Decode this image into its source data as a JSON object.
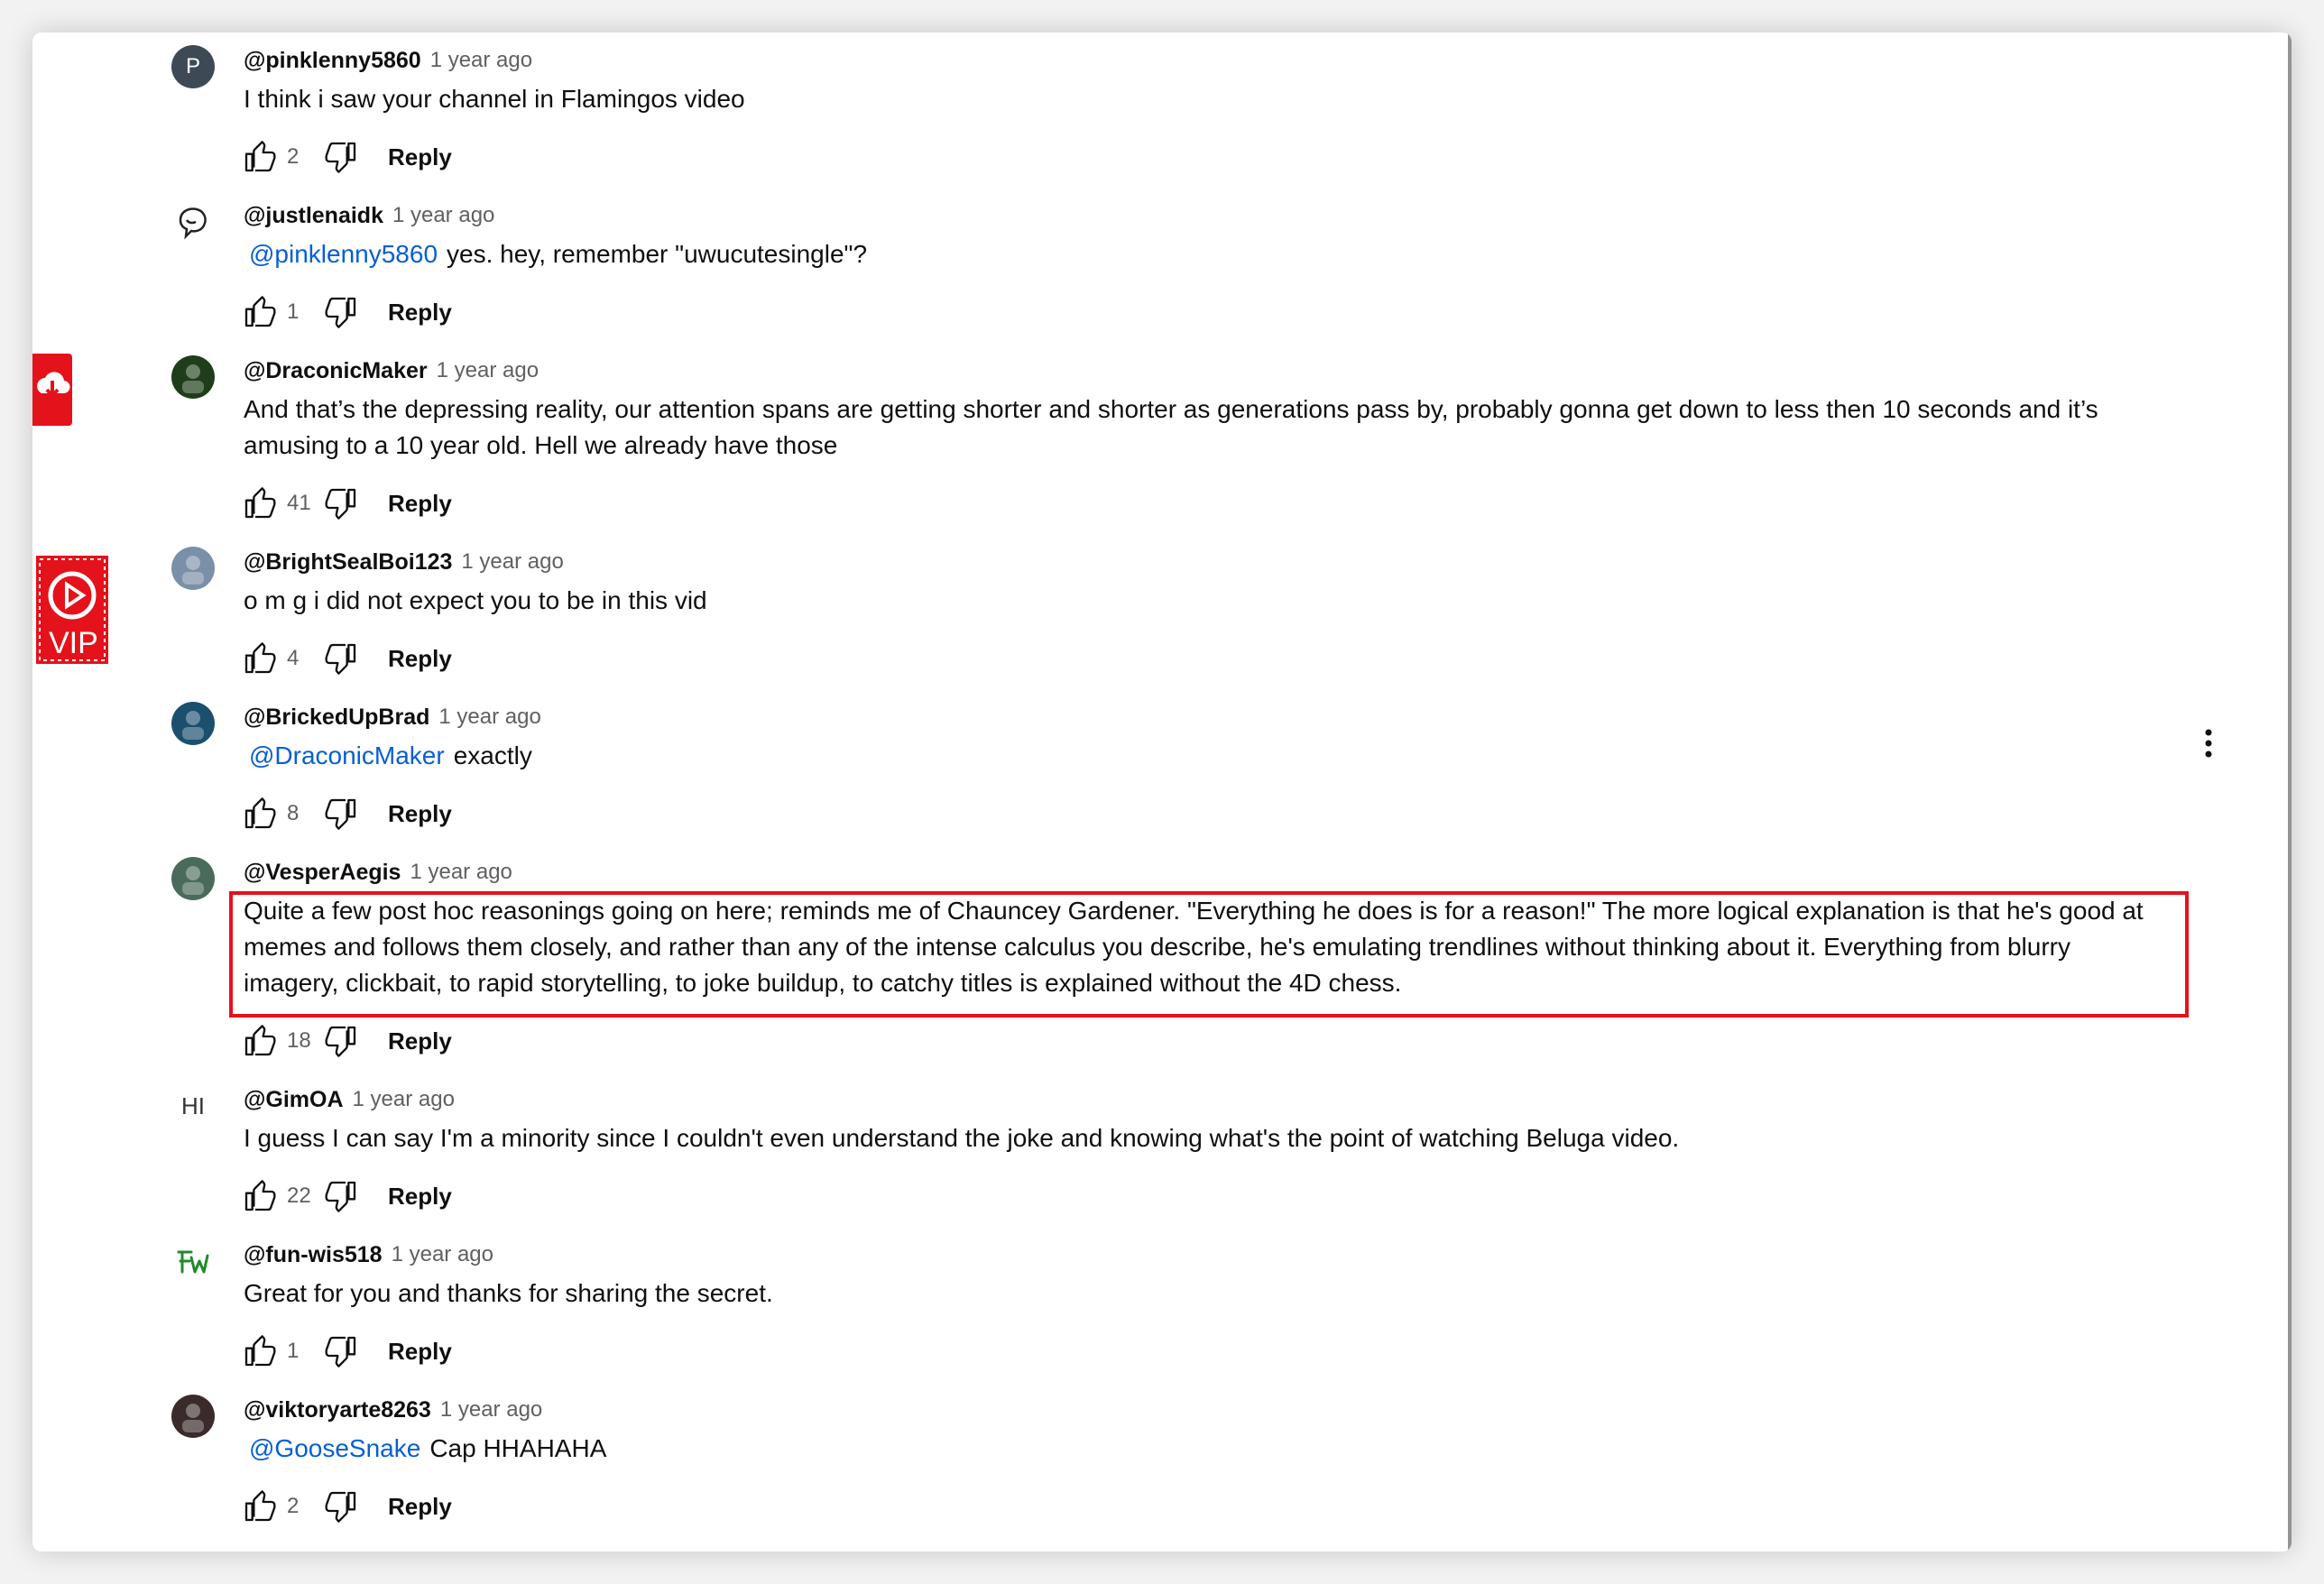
{
  "comments": [
    {
      "author": "@pinklenny5860",
      "time": "1 year ago",
      "mention": "",
      "text": "I think i saw your channel in Flamingos video",
      "likes": "2",
      "reply": "Reply",
      "avatar": {
        "letter": "P",
        "color": "#3d4a56"
      }
    },
    {
      "author": "@justlenaidk",
      "time": "1 year ago",
      "mention": "@pinklenny5860",
      "text": "yes. hey, remember \"uwucutesingle\"?",
      "likes": "1",
      "reply": "Reply",
      "avatar": {
        "letter": "",
        "color": "#ffffff"
      }
    },
    {
      "author": "@DraconicMaker",
      "time": "1 year ago",
      "mention": "",
      "text": "And that’s the depressing reality, our attention spans are getting shorter and shorter as generations pass by, probably gonna get down to less then 10 seconds and it’s amusing to a 10 year old. Hell we already have those",
      "likes": "41",
      "reply": "Reply",
      "avatar": {
        "letter": "",
        "color": "#1f3d1a"
      }
    },
    {
      "author": "@BrightSealBoi123",
      "time": "1 year ago",
      "mention": "",
      "text": "o m g i did not expect you to be in this vid",
      "likes": "4",
      "reply": "Reply",
      "avatar": {
        "letter": "",
        "color": "#7a8fa8"
      }
    },
    {
      "author": "@BrickedUpBrad",
      "time": "1 year ago",
      "mention": "@DraconicMaker",
      "text": "exactly",
      "likes": "8",
      "reply": "Reply",
      "avatar": {
        "letter": "",
        "color": "#1c4f6e"
      }
    },
    {
      "author": "@VesperAegis",
      "time": "1 year ago",
      "mention": "",
      "text": "Quite a few post hoc reasonings going on here; reminds me of Chauncey Gardener.  \"Everything he does is for a reason!\"  The more logical explanation is that he's good at memes and follows them closely, and rather than any of the intense calculus you describe, he's emulating trendlines without thinking about it.  Everything from blurry imagery, clickbait, to rapid storytelling, to joke buildup, to catchy titles is explained without the 4D chess.",
      "likes": "18",
      "reply": "Reply",
      "avatar": {
        "letter": "",
        "color": "#4b6b5a"
      }
    },
    {
      "author": "@GimOA",
      "time": "1 year ago",
      "mention": "",
      "text": "I guess I can say I'm a minority since I couldn't even understand the joke and knowing what's the point of watching Beluga video.",
      "likes": "22",
      "reply": "Reply",
      "avatar": {
        "letter": "HI",
        "color": "#ffffff"
      }
    },
    {
      "author": "@fun-wis518",
      "time": "1 year ago",
      "mention": "",
      "text": "Great for you and thanks for sharing the secret.",
      "likes": "1",
      "reply": "Reply",
      "avatar": {
        "letter": "",
        "color": "#ffffff"
      }
    },
    {
      "author": "@viktoryarte8263",
      "time": "1 year ago",
      "mention": "@GooseSnake",
      "text": "Cap HHAHAHA",
      "likes": "2",
      "reply": "Reply",
      "avatar": {
        "letter": "",
        "color": "#3a2a2a"
      }
    }
  ],
  "badges": {
    "vip_label": "VIP"
  },
  "colors": {
    "highlight": "#e4121b",
    "mention": "#065fd4",
    "badge": "#e4121b"
  }
}
